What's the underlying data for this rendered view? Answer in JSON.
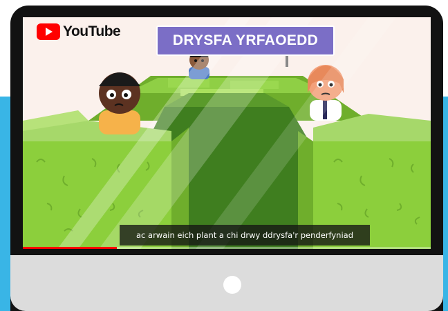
{
  "video_player": {
    "brand": "YouTube",
    "progress_fraction": 0.23,
    "progress_color": "#ff0000"
  },
  "scene": {
    "sign_text": "DRYSFA YRFAOEDD",
    "subtitle": "ac arwain eich plant a chi drwy ddrysfa'r penderfyniad"
  },
  "colors": {
    "background_band": "#39b5e6",
    "monitor_bezel": "#121212",
    "monitor_chin": "#dcdcdc",
    "hedge": "#8ccf3c",
    "sign": "#7b6ec6"
  },
  "icons": {
    "logo": "youtube-play-icon",
    "chin_button": "power-dot-icon"
  }
}
